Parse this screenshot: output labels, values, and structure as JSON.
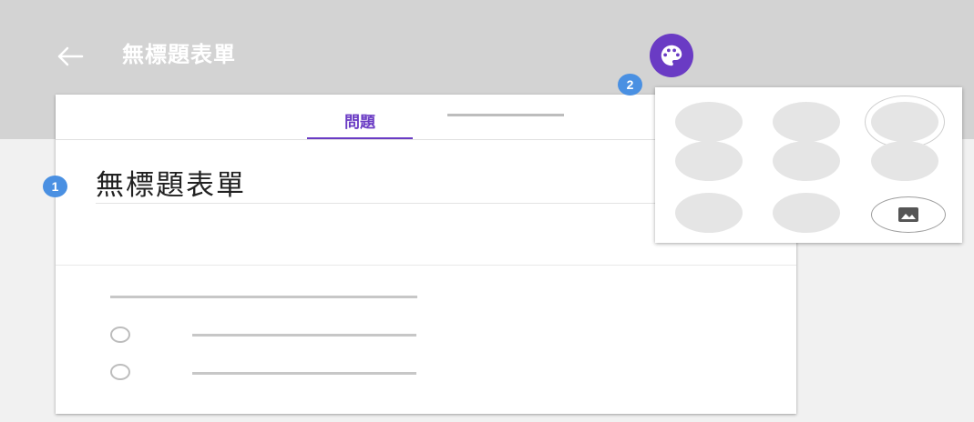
{
  "header": {
    "back_icon": "arrow-left-icon",
    "title": "無標題表單",
    "palette_icon": "palette-icon"
  },
  "tabs": {
    "questions_label": "問題"
  },
  "form": {
    "title": "無標題表單"
  },
  "badges": {
    "first": "1",
    "second": "2"
  },
  "theme_popup": {
    "swatch_count": 8,
    "image_icon": "image-icon"
  },
  "colors": {
    "accent": "#6a3bc4",
    "badge": "#4a90e2",
    "header_bg": "#d3d3d3"
  }
}
